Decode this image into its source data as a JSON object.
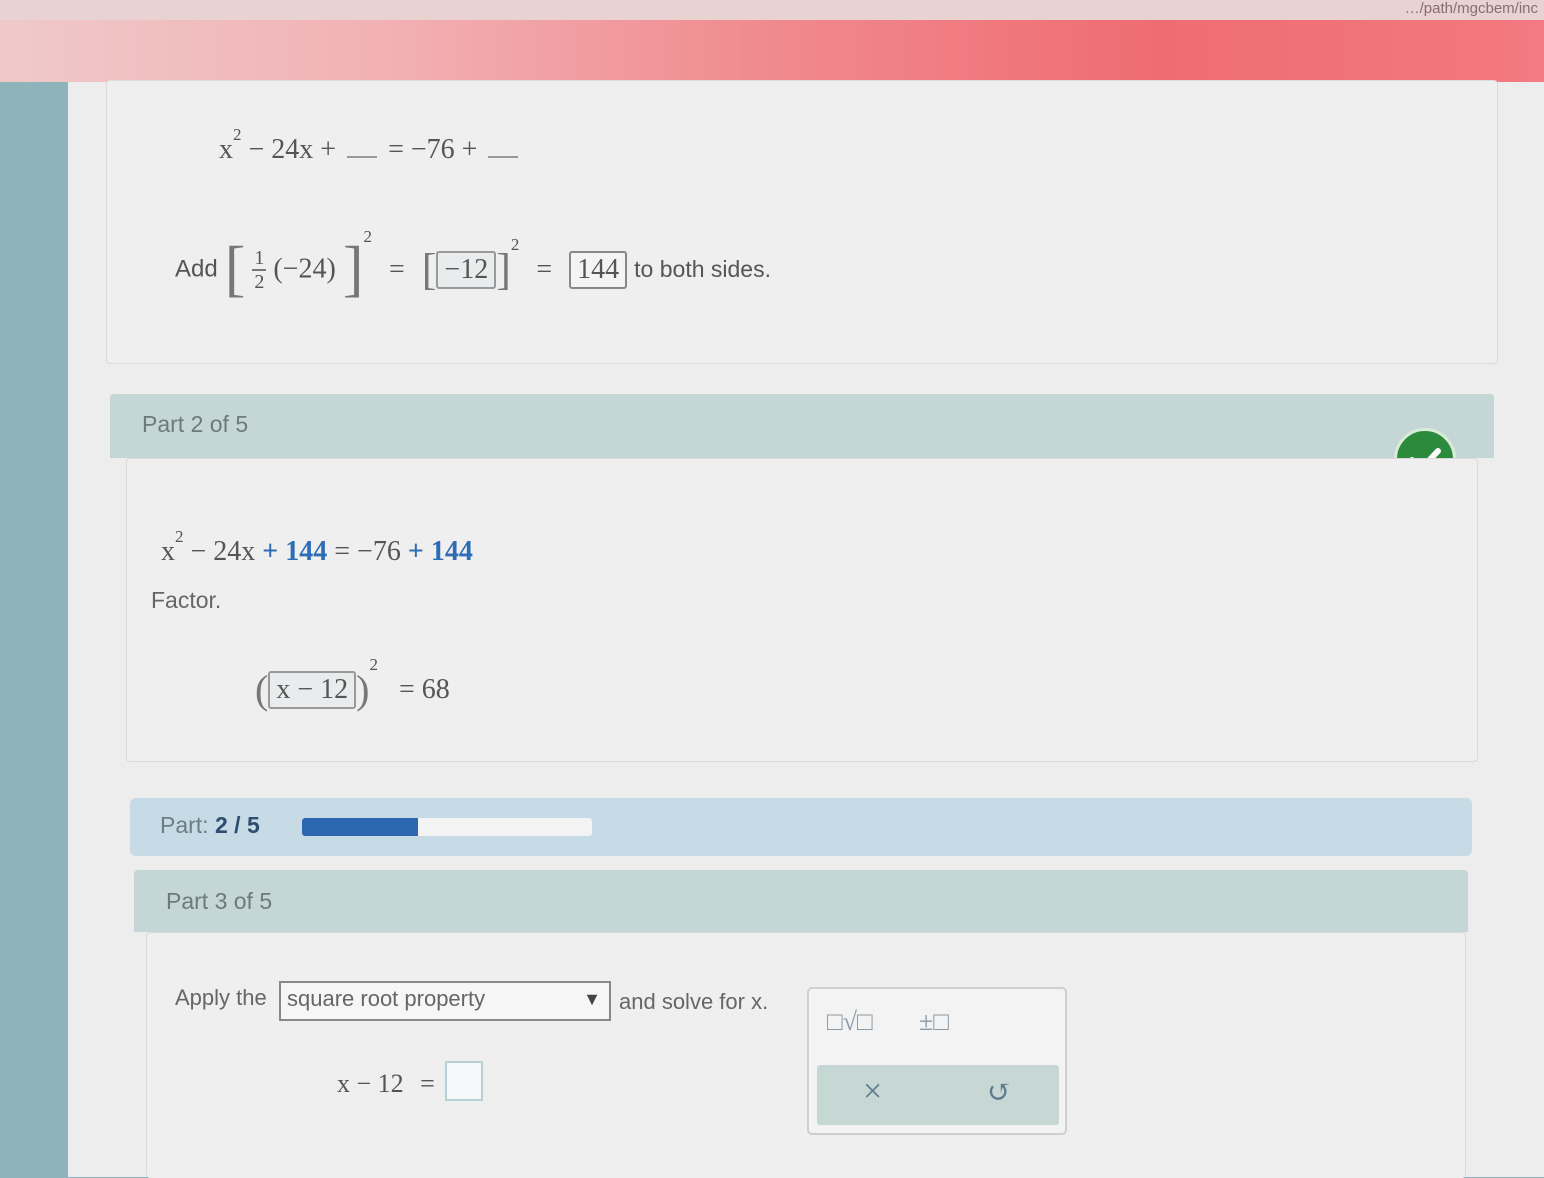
{
  "browser": {
    "url_fragment": "…/path/mgcbem/inc"
  },
  "part1": {
    "equation_lhs": "x",
    "equation_rest": "− 24x +",
    "equation_mid": "= −76 +",
    "add_label": "Add",
    "half_fraction_num": "1",
    "half_fraction_den": "2",
    "coefficient": "(−24)",
    "equals": "=",
    "half_value": "−12",
    "square_value": "144",
    "to_both_sides": "to both sides."
  },
  "part2": {
    "header": "Part 2 of 5",
    "eq_x": "x",
    "eq_minus": "− 24x",
    "eq_add1": "+ 144",
    "eq_equals": "= −76",
    "eq_add2": "+ 144",
    "factor_label": "Factor.",
    "factored_value": "x − 12",
    "factor_result": "= 68",
    "completed": true
  },
  "progress": {
    "label": "Part:",
    "current": "2",
    "separator": "/",
    "total": "5",
    "fraction": 0.4
  },
  "part3": {
    "header": "Part 3 of 5",
    "apply_label": "Apply the",
    "dropdown_selected": "square root property",
    "solve_label": "and solve for x.",
    "answer_lhs": "x − 12",
    "answer_equals": "="
  },
  "keypad": {
    "sqrt_key": "□√□",
    "plusminus_key": "±□",
    "clear_key": "×",
    "undo_key": "↺"
  },
  "colors": {
    "check_green": "#2c8a3d",
    "progress_blue": "#2c67b0",
    "header_teal": "#c4d6d6"
  }
}
